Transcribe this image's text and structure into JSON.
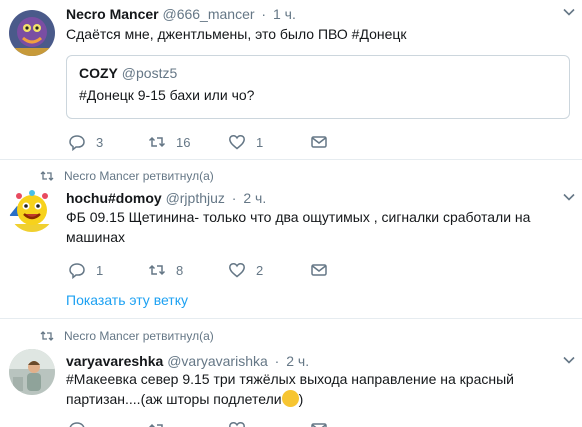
{
  "tweets": [
    {
      "name": "Necro Mancer",
      "handle": "@666_mancer",
      "time": "1 ч.",
      "text": "Сдаётся мне, джентльмены, это было ПВО #Донецк",
      "quote": {
        "name": "COZY",
        "handle": "@postz5",
        "text": "#Донецк 9-15 бахи или чо?"
      },
      "replies": "3",
      "retweets": "16",
      "likes": "1"
    },
    {
      "retweeted_by": "Necro Mancer ретвитнул(а)",
      "name": "hochu#domoy",
      "handle": "@rjpthjuz",
      "time": "2 ч.",
      "text_line1": "ФБ 09.15 Щетинина- только что два ощутимых , сигналки сработали на",
      "text_line2": "машинах",
      "replies": "1",
      "retweets": "8",
      "likes": "2",
      "show_thread": "Показать эту ветку"
    },
    {
      "retweeted_by": "Necro Mancer ретвитнул(а)",
      "name": "varyavareshka",
      "handle": "@varyavarishka",
      "time": "2 ч.",
      "text_line1": "#Макеевка север 9.15 три тяжёлых выхода направление на красный",
      "text_line2": "партизан....(аж шторы подлетели",
      "emoji": "😯",
      "text_line2_end": ")"
    }
  ],
  "dot": "·",
  "colors": {
    "link": "#1da1f2",
    "muted": "#657786",
    "border": "#e6ecf0"
  }
}
